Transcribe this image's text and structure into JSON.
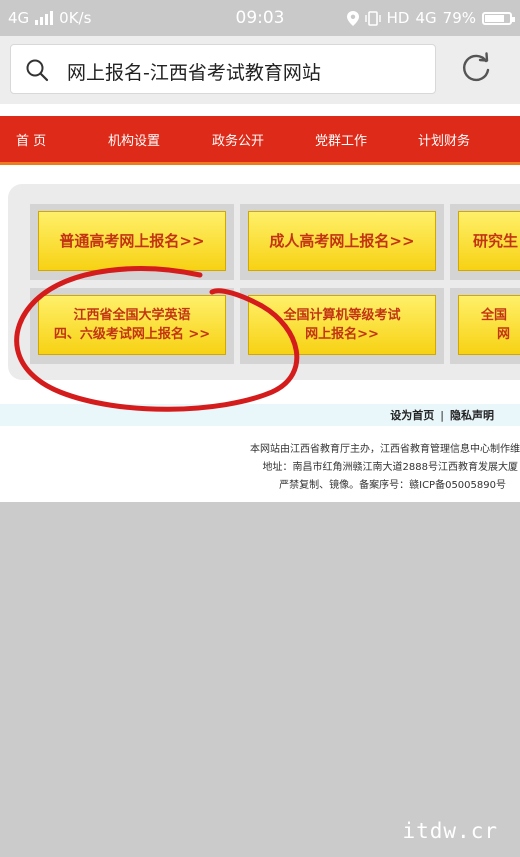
{
  "status": {
    "network": "4G",
    "speed": "0K/s",
    "time": "09:03",
    "hd_label": "HD",
    "net4g": "4G",
    "battery_percent": "79%",
    "battery_level": 0.79
  },
  "browser": {
    "title": "网上报名-江西省考试教育网站"
  },
  "nav": {
    "items": [
      "首 页",
      "机构设置",
      "政务公开",
      "党群工作",
      "计划财务"
    ]
  },
  "links": {
    "gaokao": "普通高考网上报名>>",
    "chengren": "成人高考网上报名>>",
    "yanjiusheng": "研究生",
    "cet_line1": "江西省全国大学英语",
    "cet_line2": "四、六级考试网上报名 >>",
    "ncre_line1": "全国计算机等级考试",
    "ncre_line2": "网上报名>>",
    "third_line1": "全国",
    "third_line2": "网"
  },
  "footer": {
    "homepage": "设为首页",
    "separator": "|",
    "privacy": "隐私声明",
    "line1": "本网站由江西省教育厅主办，江西省教育管理信息中心制作维",
    "line2": "地址：南昌市红角洲赣江南大道2888号江西教育发展大厦",
    "line3": "严禁复制、镜像。备案序号：赣ICP备05005890号"
  },
  "watermark": "itdw.cr",
  "colors": {
    "nav_red": "#de2a18",
    "button_yellow": "#f7d214",
    "link_red": "#c23414",
    "annotation_red": "#d41c1c"
  }
}
